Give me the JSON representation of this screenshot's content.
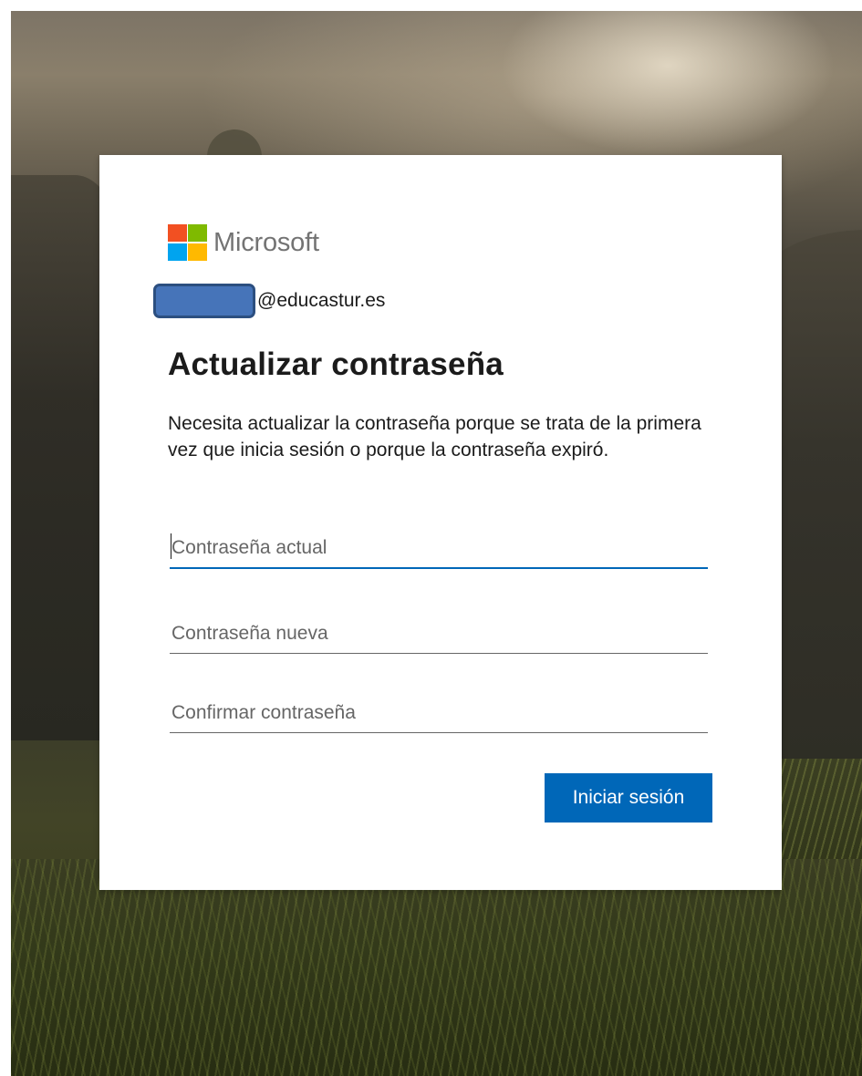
{
  "brand": {
    "name": "Microsoft",
    "logo_colors": [
      "#f25022",
      "#7fba00",
      "#00a4ef",
      "#ffb900"
    ]
  },
  "identity": {
    "email_suffix": "@educastur.es"
  },
  "form": {
    "title": "Actualizar contraseña",
    "description": "Necesita actualizar la contraseña porque se trata de la primera vez que inicia sesión o porque la contraseña expiró.",
    "current_password": {
      "placeholder": "Contraseña actual",
      "value": ""
    },
    "new_password": {
      "placeholder": "Contraseña nueva",
      "value": ""
    },
    "confirm_password": {
      "placeholder": "Confirmar contraseña",
      "value": ""
    },
    "submit_label": "Iniciar sesión"
  },
  "colors": {
    "accent": "#0067b8",
    "redaction": "#4674b9"
  }
}
